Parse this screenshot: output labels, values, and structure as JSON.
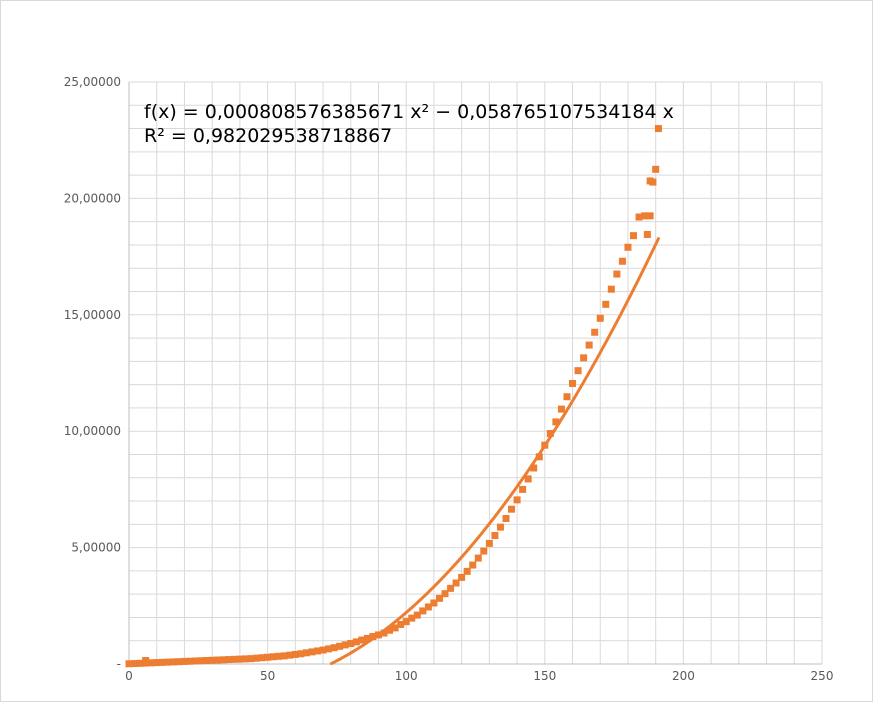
{
  "chart_data": {
    "type": "scatter",
    "xlim": [
      0,
      250
    ],
    "ylim": [
      0,
      25
    ],
    "x_ticks": [
      "0",
      "50",
      "100",
      "150",
      "200",
      "250"
    ],
    "y_ticks": [
      "-",
      "5,00000",
      "10,00000",
      "15,00000",
      "20,00000",
      "25,00000"
    ],
    "grid": true,
    "legend": "none",
    "trendline_label": {
      "line1": "f(x) = 0,000808576385671 x² − 0,058765107534184 x",
      "line2": "R² = 0,982029538718867"
    },
    "trendline": {
      "type": "polynomial",
      "x_range": [
        0,
        191
      ]
    },
    "series": [
      {
        "color": "#ED7D31",
        "marker": "square",
        "x": [
          0,
          2,
          4,
          6,
          8,
          10,
          12,
          14,
          16,
          18,
          20,
          22,
          24,
          26,
          28,
          30,
          32,
          34,
          36,
          38,
          40,
          42,
          44,
          46,
          48,
          50,
          52,
          54,
          56,
          58,
          60,
          62,
          64,
          66,
          68,
          70,
          72,
          74,
          76,
          78,
          80,
          82,
          84,
          86,
          88,
          90,
          92,
          94,
          96,
          98,
          100,
          102,
          104,
          106,
          108,
          110,
          112,
          114,
          116,
          118,
          120,
          122,
          124,
          126,
          128,
          130,
          132,
          134,
          136,
          138,
          140,
          142,
          144,
          146,
          148,
          150,
          152,
          154,
          156,
          158,
          160,
          162,
          164,
          166,
          168,
          170,
          172,
          174,
          176,
          178,
          180,
          182,
          184,
          186,
          188,
          190,
          191,
          6,
          187,
          188,
          189
        ],
        "y": [
          0.01,
          0.02,
          0.03,
          0.04,
          0.05,
          0.06,
          0.07,
          0.08,
          0.09,
          0.1,
          0.11,
          0.12,
          0.13,
          0.14,
          0.15,
          0.16,
          0.17,
          0.18,
          0.19,
          0.2,
          0.21,
          0.22,
          0.23,
          0.25,
          0.27,
          0.29,
          0.31,
          0.33,
          0.35,
          0.38,
          0.41,
          0.44,
          0.48,
          0.52,
          0.56,
          0.6,
          0.65,
          0.7,
          0.76,
          0.82,
          0.88,
          0.95,
          1.03,
          1.1,
          1.18,
          1.25,
          1.33,
          1.45,
          1.55,
          1.7,
          1.82,
          1.97,
          2.1,
          2.28,
          2.45,
          2.62,
          2.82,
          3.02,
          3.25,
          3.48,
          3.72,
          3.98,
          4.25,
          4.55,
          4.85,
          5.18,
          5.52,
          5.88,
          6.25,
          6.65,
          7.05,
          7.5,
          7.95,
          8.42,
          8.9,
          9.4,
          9.9,
          10.4,
          10.95,
          11.48,
          12.05,
          12.6,
          13.15,
          13.7,
          14.25,
          14.85,
          15.45,
          16.1,
          16.75,
          17.3,
          17.9,
          18.4,
          19.2,
          19.25,
          20.75,
          21.25,
          23.0,
          0.15,
          18.45,
          19.25,
          20.7
        ]
      }
    ]
  }
}
